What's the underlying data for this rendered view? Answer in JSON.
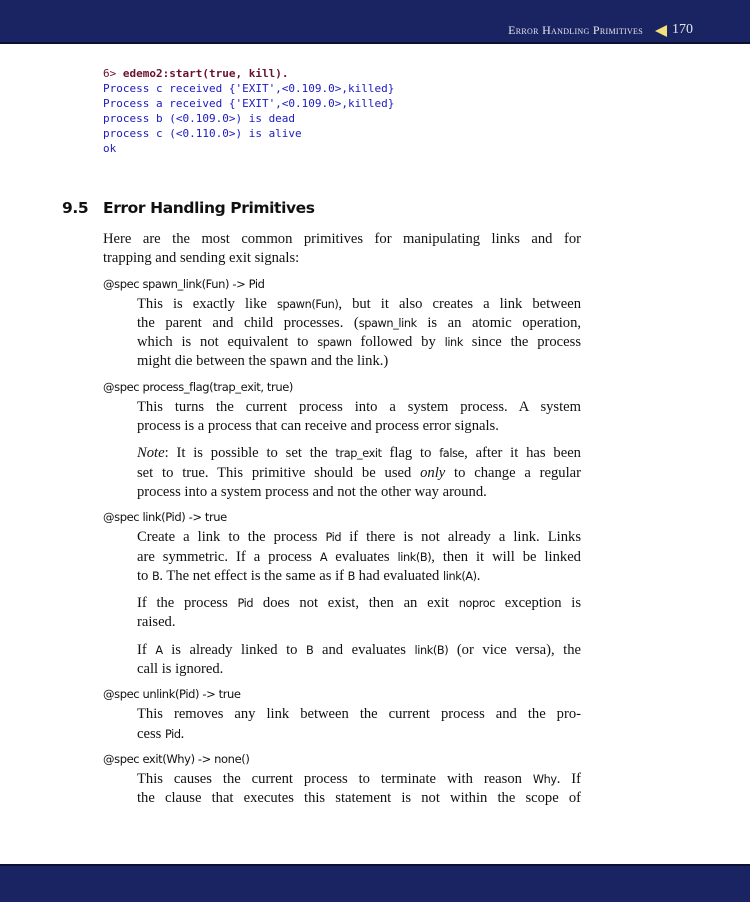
{
  "header": {
    "running_title": "Error Handling Primitives",
    "page_number": "170",
    "accent": "#f2e07a",
    "bar_color": "#1b2462"
  },
  "code": {
    "prompt": "6>",
    "command": "edemo2:start(true, kill).",
    "output": [
      "Process c received {'EXIT',<0.109.0>,killed}",
      "Process a received {'EXIT',<0.109.0>,killed}",
      "process b (<0.109.0>) is dead",
      "process c (<0.110.0>) is alive",
      "ok"
    ]
  },
  "section": {
    "number": "9.5",
    "title": "Error Handling Primitives"
  },
  "blocks": [
    {
      "type": "para",
      "indent": false,
      "lines": [
        "Here are the most common primitives for manipulating links and for",
        "trapping and sending exit signals:"
      ]
    },
    {
      "type": "spec",
      "text": "@spec spawn_link(Fun) -> Pid"
    },
    {
      "type": "para",
      "indent": true,
      "lines": [
        "This is exactly like {c:spawn(Fun)}, but it also creates a link between",
        "the parent and child processes. ({c:spawn_link} is an atomic operation,",
        "which is not equivalent to {c:spawn} followed by {c:link} since the process",
        "might die between the spawn and the link.)"
      ]
    },
    {
      "type": "spec",
      "text": "@spec process_flag(trap_exit, true)"
    },
    {
      "type": "para",
      "indent": true,
      "lines": [
        "This turns the current process into a system process. A system",
        "process is a process that can receive and process error signals."
      ]
    },
    {
      "type": "para",
      "indent": true,
      "lines": [
        "{i:Note}: It is possible to set the {c:trap_exit} flag to {c:false}, after it has been",
        "set to true. This primitive should be used {i:only} to change a regular",
        "process into a system process and not the other way around."
      ]
    },
    {
      "type": "spec",
      "text": "@spec link(Pid) -> true"
    },
    {
      "type": "para",
      "indent": true,
      "lines": [
        "Create a link to the process {c:Pid} if there is not already a link. Links",
        "are symmetric. If a process {c:A} evaluates {c:link(B)}, then it will be linked",
        "to {c:B}. The net effect is the same as if {c:B} had evaluated {c:link(A)}."
      ]
    },
    {
      "type": "para",
      "indent": true,
      "lines": [
        "If the process {c:Pid} does not exist, then an exit {c:noproc} exception is",
        "raised."
      ]
    },
    {
      "type": "para",
      "indent": true,
      "lines": [
        "If {c:A} is already linked to {c:B} and evaluates {c:link(B)} (or vice versa), the",
        "call is ignored."
      ]
    },
    {
      "type": "spec",
      "text": "@spec unlink(Pid) -> true"
    },
    {
      "type": "para",
      "indent": true,
      "lines": [
        "This removes any link between the current process and the pro-",
        "cess {c:Pid}."
      ]
    },
    {
      "type": "spec",
      "text": "@spec exit(Why) -> none()"
    },
    {
      "type": "para",
      "indent": true,
      "lines": [
        "This causes the current process to terminate with reason {c:Why}. If",
        "the clause that executes this statement is not within the scope of"
      ],
      "continues": true
    }
  ]
}
